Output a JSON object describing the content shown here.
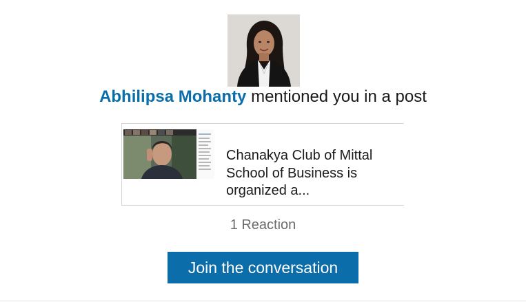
{
  "notification": {
    "author_name": "Abhilipsa Mohanty",
    "headline_suffix": " mentioned you in a post"
  },
  "post": {
    "snippet": "Chanakya Club of Mittal School of Business is organized a..."
  },
  "reactions": {
    "label": "1 Reaction"
  },
  "cta": {
    "label": "Join the conversation"
  },
  "colors": {
    "brand_blue": "#0b6eab",
    "text": "#1a1a1a",
    "muted_text": "#6b6b6b",
    "card_border": "#d5d5d5"
  },
  "icons": {
    "avatar": "profile-photo",
    "post_thumbnail": "video-call-thumbnail"
  }
}
